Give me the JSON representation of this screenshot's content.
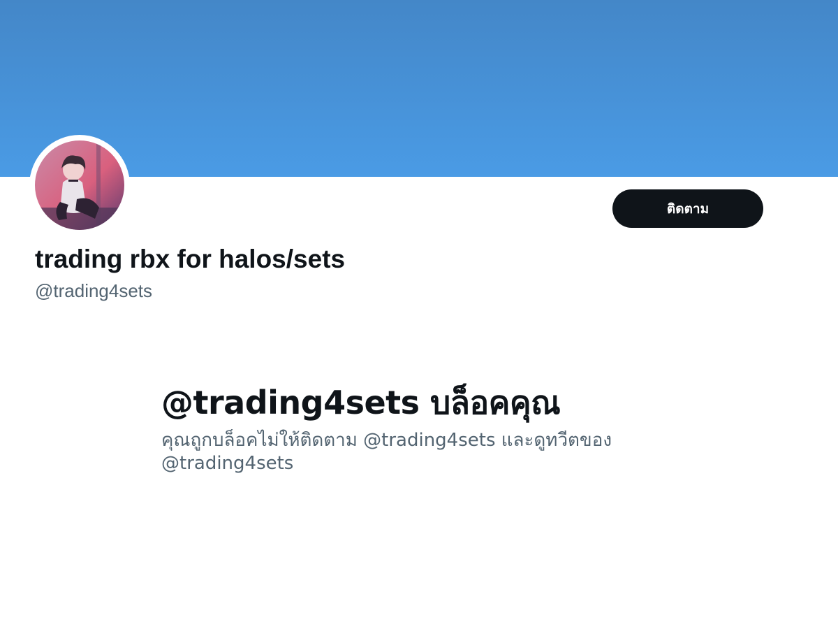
{
  "profile": {
    "display_name": "trading rbx for halos/sets",
    "handle": "@trading4sets",
    "avatar_icon": "anime-character-avatar",
    "banner_color": "#4a9be5"
  },
  "actions": {
    "follow_label": "ติดตาม"
  },
  "blocked_notice": {
    "heading": "@trading4sets บล็อคคุณ",
    "message_line1": "คุณถูกบล็อคไม่ให้ติดตาม @trading4sets และดูทวีตของ",
    "message_line2": "@trading4sets"
  },
  "colors": {
    "primary_text": "#0f1419",
    "secondary_text": "#536471",
    "button_bg": "#0f1419"
  }
}
